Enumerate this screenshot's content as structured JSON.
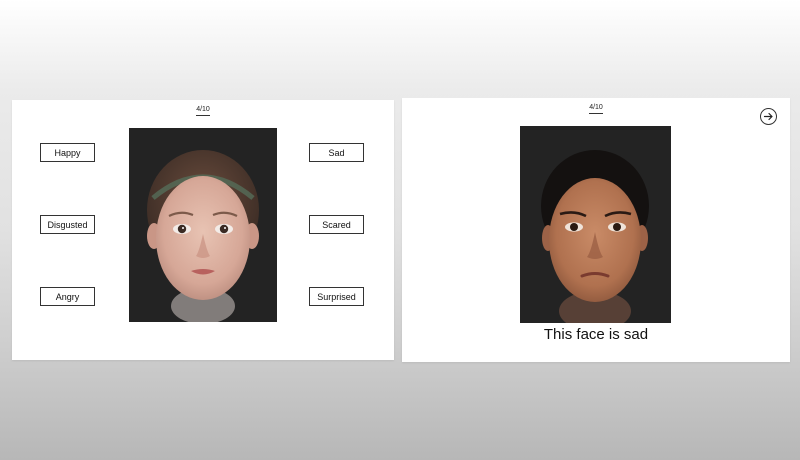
{
  "left_panel": {
    "progress": "4/10",
    "choices": [
      "Happy",
      "Disgusted",
      "Angry",
      "Sad",
      "Scared",
      "Surprised"
    ]
  },
  "right_panel": {
    "progress": "4/10",
    "feedback": "This face is sad",
    "next_icon": "arrow-right-circle-icon"
  }
}
